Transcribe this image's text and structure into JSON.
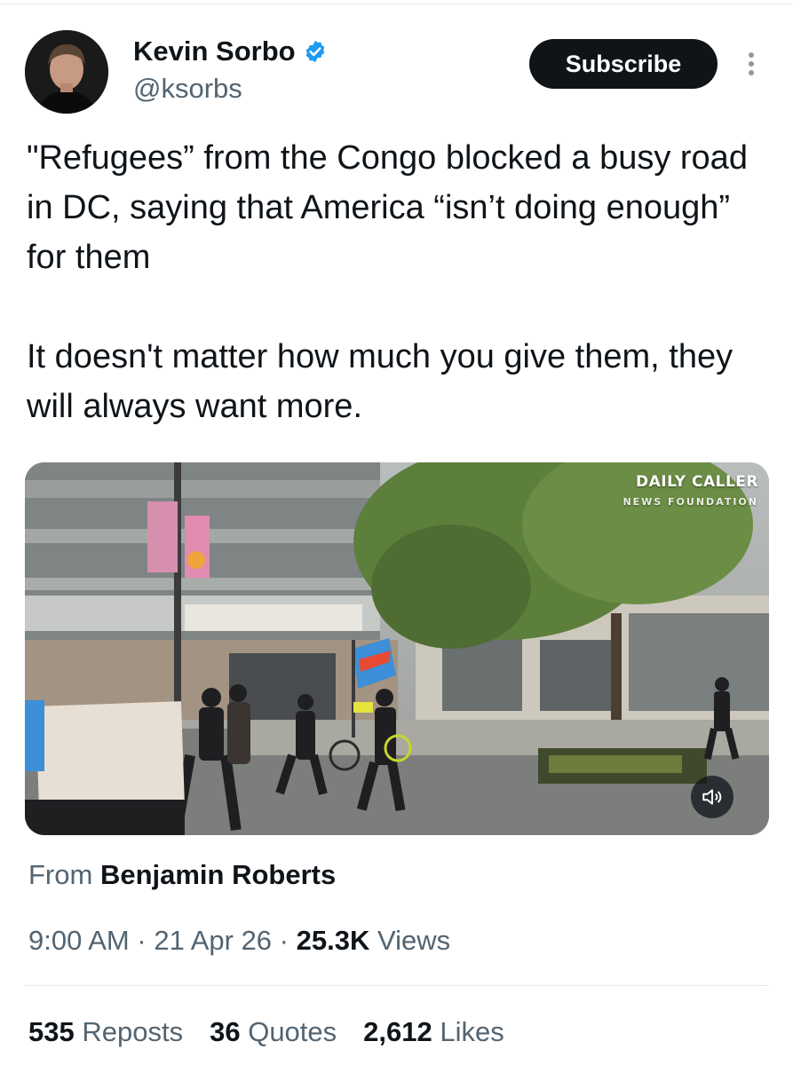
{
  "author": {
    "name": "Kevin Sorbo",
    "handle": "@ksorbs",
    "verified_color": "#1d9bf0"
  },
  "header": {
    "subscribe_label": "Subscribe",
    "more_icon": "more-vertical-icon"
  },
  "tweet": {
    "paragraph1": "\"Refugees” from the Congo blocked a busy road in DC, saying that America “isn’t doing enough” for them",
    "paragraph2": "It doesn't matter how much you give them, they will always want more."
  },
  "media": {
    "watermark_main": "DAILY CALLER",
    "watermark_sub": "NEWS FOUNDATION",
    "volume_icon": "volume-icon"
  },
  "source": {
    "prefix": "From",
    "name": "Benjamin Roberts"
  },
  "meta": {
    "time": "9:00 AM",
    "date": "21 Apr 26",
    "views_count": "25.3K",
    "views_label": "Views",
    "separator": "·"
  },
  "stats": {
    "reposts_count": "535",
    "reposts_label": "Reposts",
    "quotes_count": "36",
    "quotes_label": "Quotes",
    "likes_count": "2,612",
    "likes_label": "Likes"
  },
  "colors": {
    "text_primary": "#0f1419",
    "text_secondary": "#536471",
    "button_bg": "#0f1419"
  }
}
